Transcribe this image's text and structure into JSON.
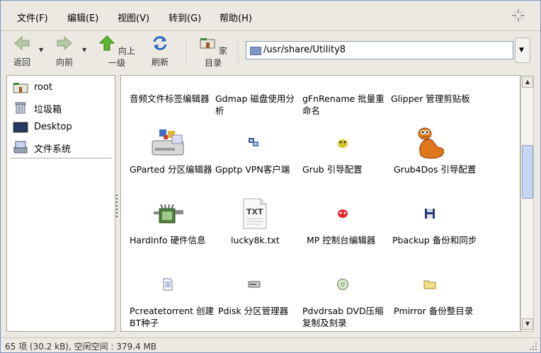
{
  "menu": [
    "文件(F)",
    "编辑(E)",
    "视图(V)",
    "转到(G)",
    "帮助(H)"
  ],
  "toolbar": {
    "back": "返回",
    "forward": "向前",
    "up": "向上一级",
    "refresh": "刷新",
    "home": "家目录"
  },
  "address": {
    "path": "/usr/share/Utility8"
  },
  "sidebar": {
    "items": [
      {
        "label": "root",
        "icon": "home-folder-icon"
      },
      {
        "label": "垃圾箱",
        "icon": "trash-icon"
      },
      {
        "label": "Desktop",
        "icon": "desktop-icon"
      },
      {
        "label": "文件系统",
        "icon": "filesystem-icon"
      }
    ]
  },
  "files": [
    {
      "name": "音频文件标签编辑器",
      "icon": "audio-tag-icon"
    },
    {
      "name": "Gdmap 磁盘使用分析",
      "icon": "gdmap-icon"
    },
    {
      "name": "gFnRename 批量重命名",
      "icon": "rename-icon"
    },
    {
      "name": "Glipper 管理剪贴板",
      "icon": "clipboard-icon"
    },
    {
      "name": "GParted 分区编辑器",
      "icon": "gparted-icon"
    },
    {
      "name": "Gpptp VPN客户端",
      "icon": "vpn-icon"
    },
    {
      "name": "Grub 引导配置",
      "icon": "grub-icon"
    },
    {
      "name": "Grub4Dos 引导配置",
      "icon": "worm-icon"
    },
    {
      "name": "HardInfo 硬件信息",
      "icon": "hardinfo-icon"
    },
    {
      "name": "lucky8k.txt",
      "icon": "txt-file-icon"
    },
    {
      "name": "MP 控制台编辑器",
      "icon": "mp-icon"
    },
    {
      "name": "Pbackup 备份和同步",
      "icon": "floppy-icon"
    },
    {
      "name": "Pcreatetorrent 创建BT种子",
      "icon": "document-icon"
    },
    {
      "name": "Pdisk 分区管理器",
      "icon": "disk-icon"
    },
    {
      "name": "Pdvdrsab DVD压缩复制及刻录",
      "icon": "cd-icon"
    },
    {
      "name": "Pmirror 备份整目录",
      "icon": "folder-icon"
    }
  ],
  "status": {
    "text": "65 项 (30.2 kB), 空闲空间 : 379.4 MB"
  },
  "colors": {
    "accent": "#3a6ea5",
    "window_bg": "#ebe9e1",
    "scroll_thumb": "#c5d6f2"
  }
}
